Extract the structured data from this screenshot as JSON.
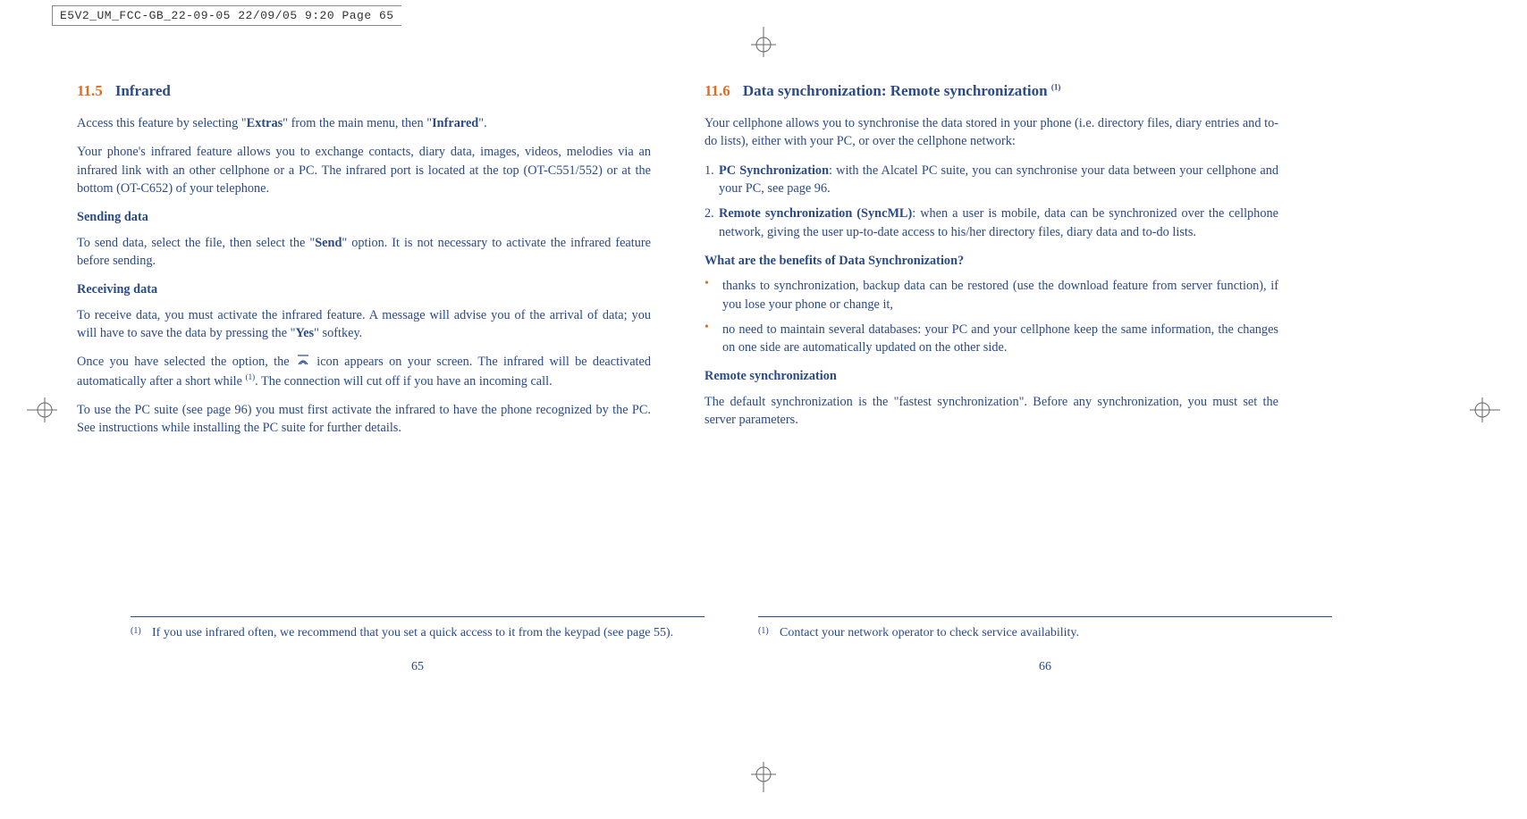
{
  "header": "E5V2_UM_FCC-GB_22-09-05  22/09/05  9:20  Page 65",
  "left": {
    "sec_num": "11.5",
    "sec_title": "Infrared",
    "p1_a": "Access this feature by selecting \"",
    "p1_b": "Extras",
    "p1_c": "\" from the main menu, then \"",
    "p1_d": "Infrared",
    "p1_e": "\".",
    "p2": "Your phone's infrared feature allows you to exchange contacts, diary data, images, videos, melodies via an infrared link with an other cellphone or a PC. The infrared port is located at the top (OT-C551/552) or at the bottom (OT-C652) of your telephone.",
    "h1": "Sending data",
    "p3_a": "To send data, select the file, then select the \"",
    "p3_b": "Send",
    "p3_c": "\" option. It is not necessary to activate the infrared feature before sending.",
    "h2": "Receiving data",
    "p4_a": "To receive data, you must activate the infrared feature. A message will advise you of the arrival of data; you will have to save the data by pressing the \"",
    "p4_b": "Yes",
    "p4_c": "\" softkey.",
    "p5_a": "Once you have selected the option, the ",
    "p5_b": " icon appears on your screen. The infrared will be deactivated automatically after a short while ",
    "p5_c": ". The connection will cut off if you have an incoming call.",
    "p6": "To use the PC suite (see page 96) you must first activate the infrared to have the phone recognized by the PC. See instructions while installing the PC suite for further details.",
    "fn_marker": "(1)",
    "fn": "If you use infrared often, we recommend that you set a quick access to it from the keypad (see page 55).",
    "pageno": "65"
  },
  "right": {
    "sec_num": "11.6",
    "sec_title_a": "Data synchronization: Remote synchronization ",
    "sec_title_sup": "(1)",
    "p1": "Your cellphone allows you to synchronise the data stored in your phone (i.e. directory files, diary entries and to-do lists), either with your PC, or over the cellphone network:",
    "ol": [
      {
        "num": "1.",
        "bold": "PC Synchronization",
        "rest": ": with the Alcatel PC suite, you can synchronise your data between your cellphone and your PC, see page 96."
      },
      {
        "num": "2.",
        "bold": "Remote synchronization (SyncML)",
        "rest": ": when a user is mobile, data can be synchronized over the cellphone network, giving the user up-to-date access to his/her directory files, diary data and to-do lists."
      }
    ],
    "h1": "What are the benefits of Data Synchronization?",
    "ul": [
      "thanks to synchronization, backup data can be restored (use the download feature from server function), if you lose your phone or change it,",
      "no need to maintain several databases: your PC and your cellphone keep the same information, the changes on one side are automatically updated on the other side."
    ],
    "h2": "Remote synchronization",
    "p2": "The default synchronization is the \"fastest synchronization\". Before any synchronization, you must set the server parameters.",
    "fn_marker": "(1)",
    "fn": "Contact your network operator to check service availability.",
    "pageno": "66"
  }
}
